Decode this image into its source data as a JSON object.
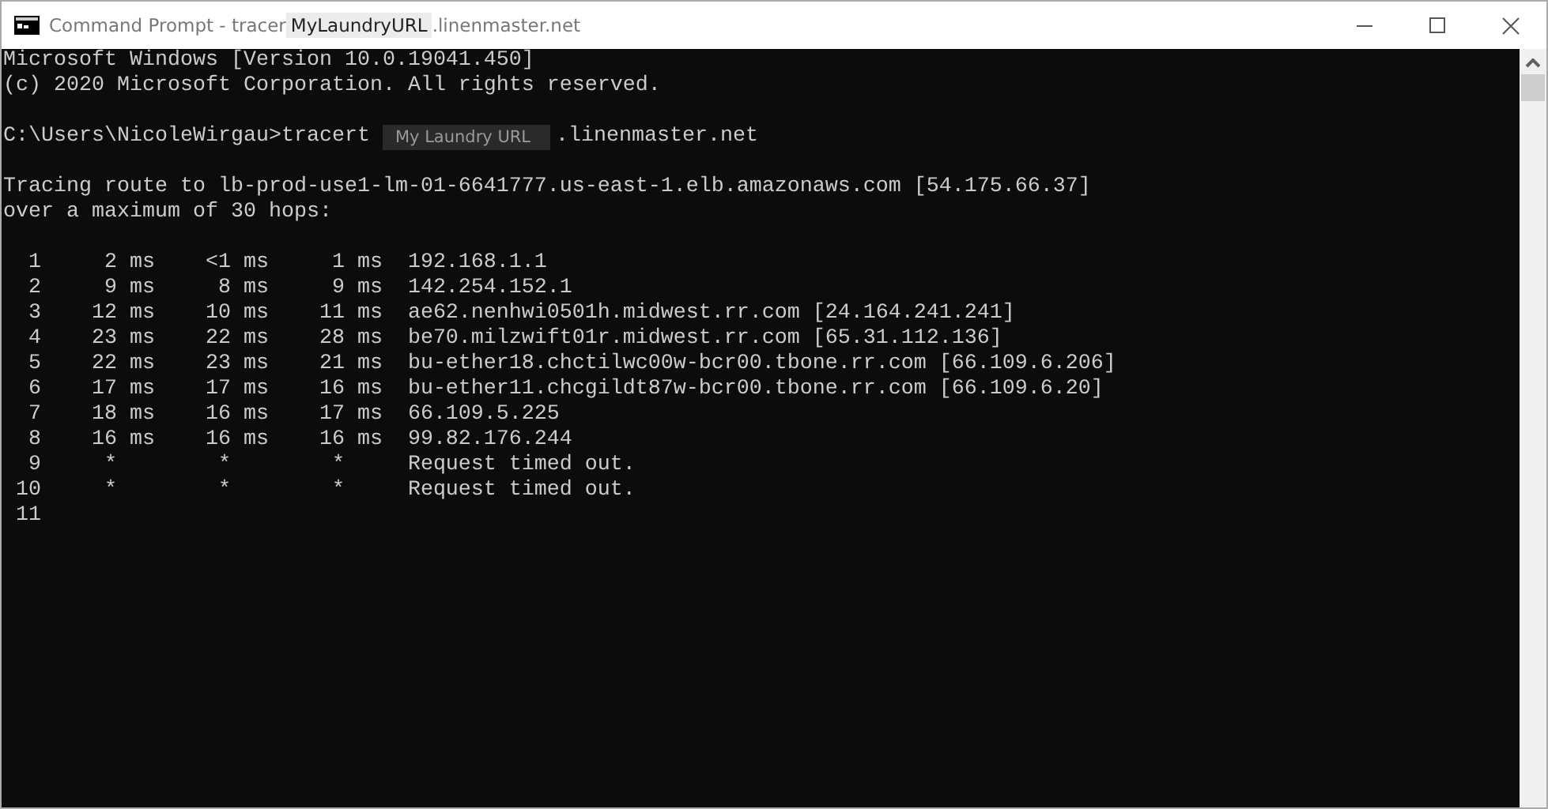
{
  "window": {
    "title_prefix": "Command Prompt - tracer",
    "title_redaction": "MyLaundryURL",
    "title_suffix": ".linenmaster.net"
  },
  "console": {
    "header_lines": [
      "Microsoft Windows [Version 10.0.19041.450]",
      "(c) 2020 Microsoft Corporation. All rights reserved."
    ],
    "command": {
      "prompt": "C:\\Users\\NicoleWirgau>tracert",
      "redaction": "My Laundry URL",
      "suffix": ".linenmaster.net"
    },
    "output_lines": [
      "Tracing route to lb-prod-use1-lm-01-6641777.us-east-1.elb.amazonaws.com [54.175.66.37]",
      "over a maximum of 30 hops:"
    ],
    "hops": [
      "  1     2 ms    <1 ms     1 ms  192.168.1.1",
      "  2     9 ms     8 ms     9 ms  142.254.152.1",
      "  3    12 ms    10 ms    11 ms  ae62.nenhwi0501h.midwest.rr.com [24.164.241.241]",
      "  4    23 ms    22 ms    28 ms  be70.milzwift01r.midwest.rr.com [65.31.112.136]",
      "  5    22 ms    23 ms    21 ms  bu-ether18.chctilwc00w-bcr00.tbone.rr.com [66.109.6.206]",
      "  6    17 ms    17 ms    16 ms  bu-ether11.chcgildt87w-bcr00.tbone.rr.com [66.109.6.20]",
      "  7    18 ms    16 ms    17 ms  66.109.5.225",
      "  8    16 ms    16 ms    16 ms  99.82.176.244",
      "  9     *        *        *     Request timed out.",
      " 10     *        *        *     Request timed out.",
      " 11"
    ]
  }
}
